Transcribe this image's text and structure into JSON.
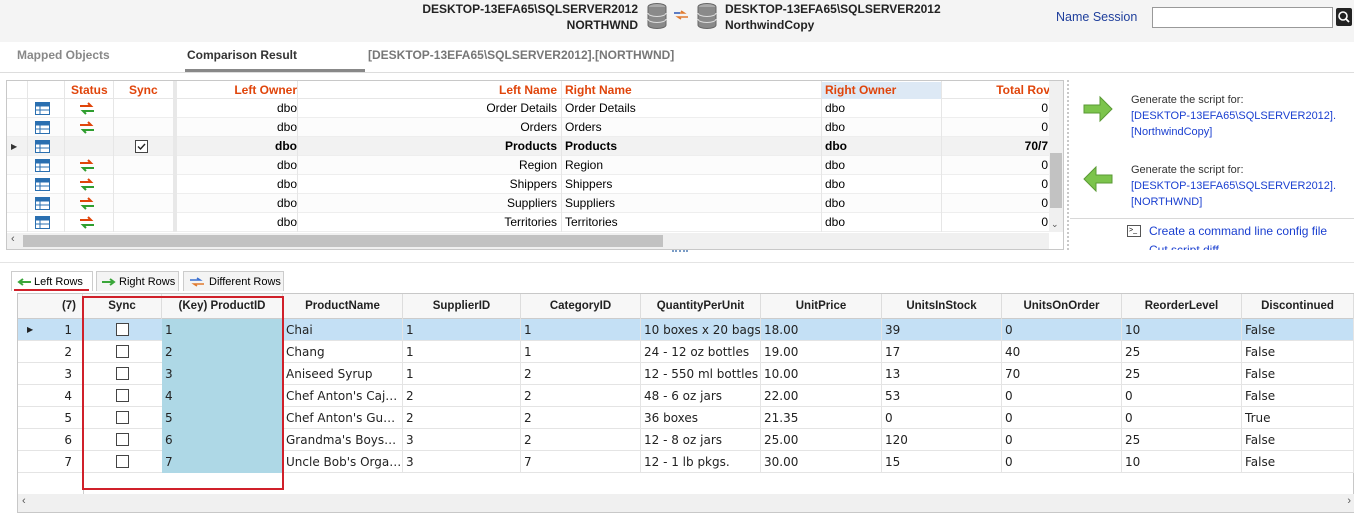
{
  "header": {
    "left_server": "DESKTOP-13EFA65\\SQLSERVER2012",
    "left_db": "NORTHWND",
    "right_server": "DESKTOP-13EFA65\\SQLSERVER2012",
    "right_db": "NorthwindCopy",
    "name_session_label": "Name Session",
    "session_value": ""
  },
  "tabs": {
    "mapped": "Mapped Objects",
    "comparison": "Comparison Result",
    "path": "[DESKTOP-13EFA65\\SQLSERVER2012].[NORTHWND]"
  },
  "top_grid": {
    "headers": {
      "status": "Status",
      "sync": "Sync",
      "left_owner": "Left Owner",
      "left_name": "Left Name",
      "right_name": "Right Name",
      "right_owner": "Right Owner",
      "total_rows": "Total Rov"
    },
    "rows": [
      {
        "left_owner": "dbo",
        "left_name": "Order Details",
        "right_name": "Order Details",
        "right_owner": "dbo",
        "total": "0"
      },
      {
        "left_owner": "dbo",
        "left_name": "Orders",
        "right_name": "Orders",
        "right_owner": "dbo",
        "total": "0"
      },
      {
        "left_owner": "dbo",
        "left_name": "Products",
        "right_name": "Products",
        "right_owner": "dbo",
        "total": "70/7"
      },
      {
        "left_owner": "dbo",
        "left_name": "Region",
        "right_name": "Region",
        "right_owner": "dbo",
        "total": "0"
      },
      {
        "left_owner": "dbo",
        "left_name": "Shippers",
        "right_name": "Shippers",
        "right_owner": "dbo",
        "total": "0"
      },
      {
        "left_owner": "dbo",
        "left_name": "Suppliers",
        "right_name": "Suppliers",
        "right_owner": "dbo",
        "total": "0"
      },
      {
        "left_owner": "dbo",
        "left_name": "Territories",
        "right_name": "Territories",
        "right_owner": "dbo",
        "total": "0"
      }
    ]
  },
  "right_panel": {
    "gen1_label": "Generate the script for:",
    "gen1_line1": "[DESKTOP-13EFA65\\SQLSERVER2012].",
    "gen1_line2": "[NorthwindCopy]",
    "gen2_label": "Generate the script for:",
    "gen2_line1": "[DESKTOP-13EFA65\\SQLSERVER2012].",
    "gen2_line2": "[NORTHWND]",
    "cmd_link": "Create a command line config file",
    "cut_link": "Cut script diff"
  },
  "bottom_tabs": {
    "left": "Left Rows",
    "right": "Right Rows",
    "diff": "Different Rows"
  },
  "bottom_grid": {
    "count": "(7)",
    "headers": [
      "Sync",
      "(Key) ProductID",
      "ProductName",
      "SupplierID",
      "CategoryID",
      "QuantityPerUnit",
      "UnitPrice",
      "UnitsInStock",
      "UnitsOnOrder",
      "ReorderLevel",
      "Discontinued"
    ],
    "rows": [
      {
        "n": "1",
        "id": "1",
        "name": "Chai",
        "sup": "1",
        "cat": "1",
        "qty": "10 boxes x 20 bags",
        "price": "18.00",
        "stock": "39",
        "order": "0",
        "reorder": "10",
        "disc": "False"
      },
      {
        "n": "2",
        "id": "2",
        "name": "Chang",
        "sup": "1",
        "cat": "1",
        "qty": "24 - 12 oz bottles",
        "price": "19.00",
        "stock": "17",
        "order": "40",
        "reorder": "25",
        "disc": "False"
      },
      {
        "n": "3",
        "id": "3",
        "name": "Aniseed Syrup",
        "sup": "1",
        "cat": "2",
        "qty": "12 - 550 ml bottles",
        "price": "10.00",
        "stock": "13",
        "order": "70",
        "reorder": "25",
        "disc": "False"
      },
      {
        "n": "4",
        "id": "4",
        "name": "Chef Anton's Caj…",
        "sup": "2",
        "cat": "2",
        "qty": "48 - 6 oz jars",
        "price": "22.00",
        "stock": "53",
        "order": "0",
        "reorder": "0",
        "disc": "False"
      },
      {
        "n": "5",
        "id": "5",
        "name": "Chef Anton's Gu…",
        "sup": "2",
        "cat": "2",
        "qty": "36 boxes",
        "price": "21.35",
        "stock": "0",
        "order": "0",
        "reorder": "0",
        "disc": "True"
      },
      {
        "n": "6",
        "id": "6",
        "name": "Grandma's Boys…",
        "sup": "3",
        "cat": "2",
        "qty": "12 - 8 oz jars",
        "price": "25.00",
        "stock": "120",
        "order": "0",
        "reorder": "25",
        "disc": "False"
      },
      {
        "n": "7",
        "id": "7",
        "name": "Uncle Bob's Orga…",
        "sup": "3",
        "cat": "7",
        "qty": "12 - 1 lb pkgs.",
        "price": "30.00",
        "stock": "15",
        "order": "0",
        "reorder": "10",
        "disc": "False"
      }
    ]
  },
  "colors": {
    "header_orange": "#e0450b",
    "key_column": "#aed8e6",
    "selected_row": "#c4e0f5",
    "highlight_box": "#d0202a"
  }
}
